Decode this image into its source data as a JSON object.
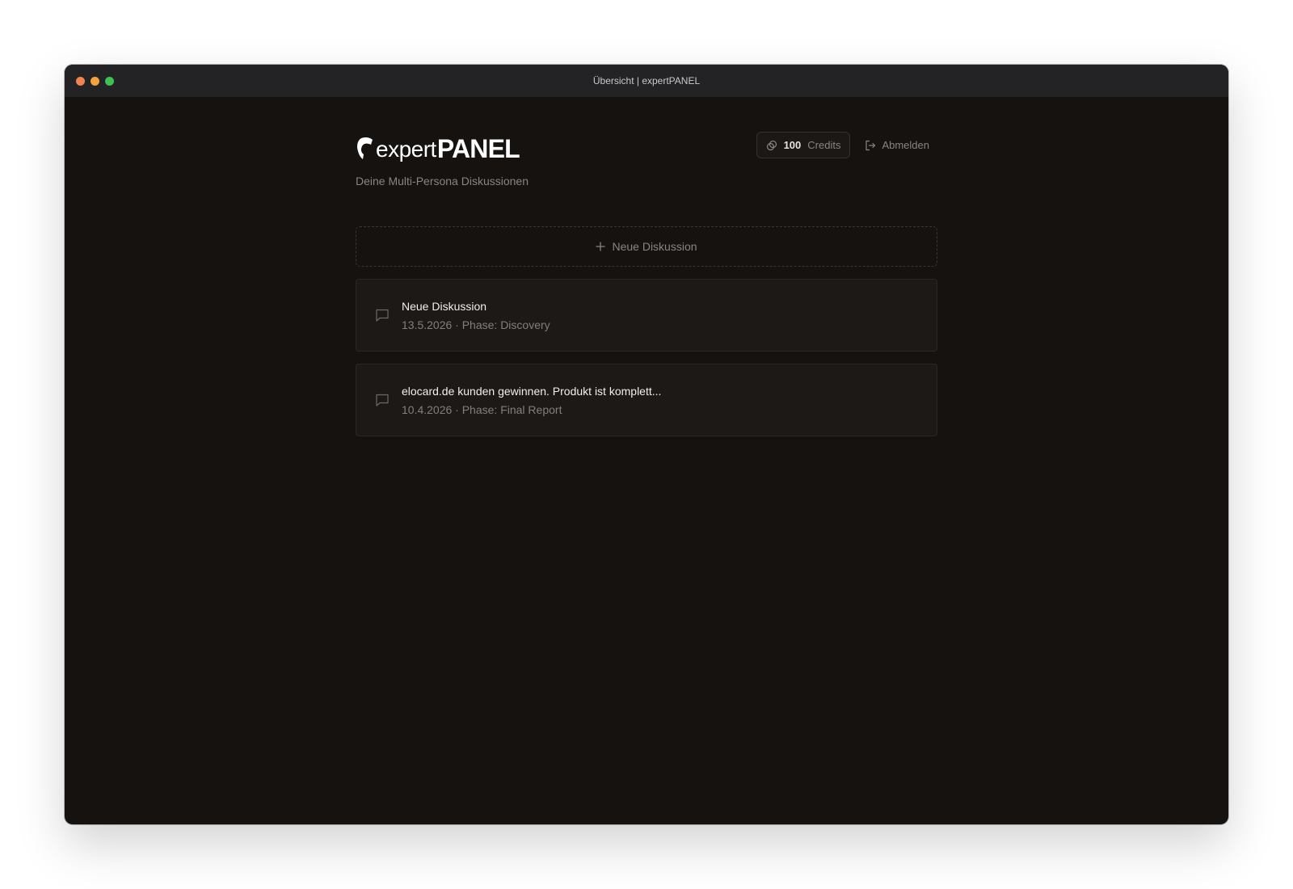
{
  "window": {
    "title": "Übersicht | expertPANEL"
  },
  "brand": {
    "name_light": "expert",
    "name_bold": "PANEL",
    "subtitle": "Deine Multi-Persona Diskussionen"
  },
  "header": {
    "credits_value": "100",
    "credits_label": "Credits",
    "logout_label": "Abmelden"
  },
  "new_discussion": {
    "label": "Neue Diskussion"
  },
  "discussions": [
    {
      "title": "Neue Diskussion",
      "meta": "13.5.2026 · Phase: Discovery"
    },
    {
      "title": "elocard.de kunden gewinnen. Produkt ist komplett...",
      "meta": "10.4.2026 · Phase: Final Report"
    }
  ],
  "colors": {
    "background": "#151210",
    "card": "#1c1917",
    "titlebar": "#232326",
    "text_primary": "#f2efec",
    "text_muted": "#8a8581"
  },
  "icons": {
    "credits": "coins-icon",
    "logout": "logout-icon",
    "new": "plus-icon",
    "discussion": "chat-bubble-icon"
  }
}
